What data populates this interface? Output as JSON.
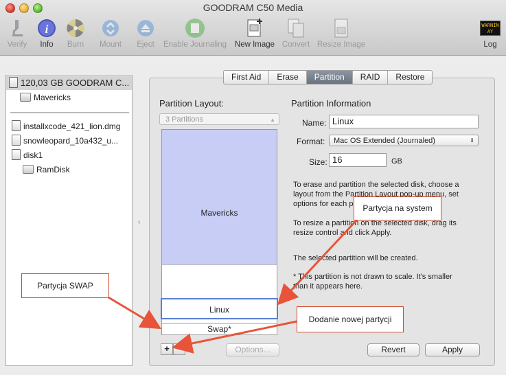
{
  "window": {
    "title": "GOODRAM C50 Media"
  },
  "toolbar": {
    "items": [
      {
        "label": "Verify",
        "icon": "microscope-icon",
        "enabled": false
      },
      {
        "label": "Info",
        "icon": "info-icon",
        "enabled": true
      },
      {
        "label": "Burn",
        "icon": "burn-icon",
        "enabled": false
      },
      {
        "label": "Mount",
        "icon": "mount-icon",
        "enabled": false
      },
      {
        "label": "Eject",
        "icon": "eject-icon",
        "enabled": false
      },
      {
        "label": "Enable Journaling",
        "icon": "journaling-icon",
        "enabled": false
      },
      {
        "label": "New Image",
        "icon": "new-image-icon",
        "enabled": true
      },
      {
        "label": "Convert",
        "icon": "convert-icon",
        "enabled": false
      },
      {
        "label": "Resize Image",
        "icon": "resize-image-icon",
        "enabled": false
      },
      {
        "label": "Log",
        "icon": "log-icon",
        "enabled": true
      }
    ],
    "log_badge_line1": "WARNIN",
    "log_badge_line2": "AY 7:36"
  },
  "sidebar": {
    "items": [
      {
        "label": "120,03 GB GOODRAM C...",
        "type": "disk",
        "selected": true
      },
      {
        "label": "Mavericks",
        "type": "volume"
      },
      {
        "label": "installxcode_421_lion.dmg",
        "type": "image"
      },
      {
        "label": "snowleopard_10a432_u...",
        "type": "image"
      },
      {
        "label": "disk1",
        "type": "disk"
      },
      {
        "label": "RamDisk",
        "type": "volume"
      }
    ]
  },
  "tabs": [
    "First Aid",
    "Erase",
    "Partition",
    "RAID",
    "Restore"
  ],
  "active_tab": "Partition",
  "partition_layout": {
    "heading": "Partition Layout:",
    "popup_value": "3 Partitions",
    "partitions": [
      "Mavericks",
      "Linux",
      "Swap*"
    ],
    "add_label": "+",
    "remove_label": "−",
    "options_label": "Options..."
  },
  "partition_info": {
    "heading": "Partition Information",
    "name_label": "Name:",
    "name_value": "Linux",
    "format_label": "Format:",
    "format_value": "Mac OS Extended (Journaled)",
    "size_label": "Size:",
    "size_value": "16",
    "size_unit": "GB",
    "paragraph1a": "To erase and partition the selected disk, choose a",
    "paragraph1b": "layout from the Partition Layout pop-up menu, set",
    "paragraph1c": "options for each partition, and click Apply.",
    "paragraph2a": "To resize a partition on the selected disk, drag its",
    "paragraph2b": "resize control and click Apply.",
    "paragraph3": "The selected partition will be created.",
    "paragraph4a": "* This partition is not drawn to scale. It's smaller",
    "paragraph4b": "than it appears here."
  },
  "buttons": {
    "revert": "Revert",
    "apply": "Apply"
  },
  "callouts": {
    "system": "Partycja na system",
    "swap": "Partycja SWAP",
    "new_partition": "Dodanie nowej partycji"
  },
  "colors": {
    "accent_arrow": "#e8543a",
    "partition_fill": "#c8cdf5",
    "active_tab": "#7a848f"
  }
}
